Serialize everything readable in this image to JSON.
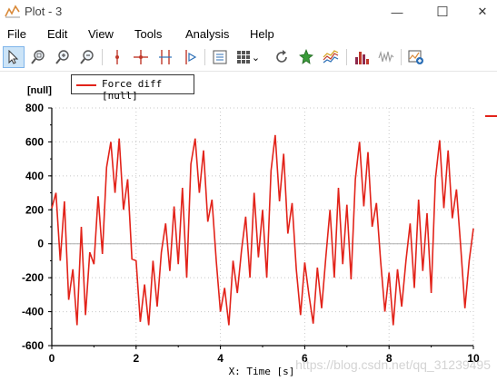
{
  "window": {
    "title": "Plot - 3"
  },
  "window_controls": {
    "minimize": "—",
    "maximize": "☐",
    "close": "✕"
  },
  "menu": {
    "items": [
      "File",
      "Edit",
      "View",
      "Tools",
      "Analysis",
      "Help"
    ]
  },
  "toolbar": {
    "buttons": [
      "select-arrow-icon",
      "zoom-region-icon",
      "zoom-in-icon",
      "zoom-out-icon",
      "cursor-vertical-icon",
      "cursor-cross-icon",
      "cursor-pair-icon",
      "cursor-step-icon",
      "properties-list-icon",
      "layout-grid-icon",
      "refresh-icon",
      "pin-icon",
      "multi-line-icon",
      "histogram-icon",
      "waveform-icon",
      "new-plot-icon"
    ],
    "dropdown_arrow": "⌄"
  },
  "plot": {
    "y_unit": "[null]",
    "legend_label": "Force diff [null]",
    "x_axis_label": "X: Time [s]",
    "line_color": "#e2231a"
  },
  "watermark": "https://blog.csdn.net/qq_31239495",
  "chart_data": {
    "type": "line",
    "title": "",
    "xlabel": "X: Time [s]",
    "ylabel": "[null]",
    "xlim": [
      0,
      10
    ],
    "ylim": [
      -600,
      800
    ],
    "x_ticks": [
      0,
      2,
      4,
      6,
      8,
      10
    ],
    "y_ticks": [
      -600,
      -400,
      -200,
      0,
      200,
      400,
      600,
      800
    ],
    "grid": true,
    "legend_position": "top-left",
    "series": [
      {
        "name": "Force diff [null]",
        "color": "#e2231a",
        "x": [
          0.0,
          0.1,
          0.2,
          0.3,
          0.4,
          0.5,
          0.6,
          0.7,
          0.8,
          0.9,
          1.0,
          1.1,
          1.2,
          1.3,
          1.4,
          1.5,
          1.6,
          1.7,
          1.8,
          1.9,
          2.0,
          2.1,
          2.2,
          2.3,
          2.4,
          2.5,
          2.6,
          2.7,
          2.8,
          2.9,
          3.0,
          3.1,
          3.2,
          3.3,
          3.4,
          3.5,
          3.6,
          3.7,
          3.8,
          3.9,
          4.0,
          4.1,
          4.2,
          4.3,
          4.4,
          4.5,
          4.6,
          4.7,
          4.8,
          4.9,
          5.0,
          5.1,
          5.2,
          5.3,
          5.4,
          5.5,
          5.6,
          5.7,
          5.8,
          5.9,
          6.0,
          6.1,
          6.2,
          6.3,
          6.4,
          6.5,
          6.6,
          6.7,
          6.8,
          6.9,
          7.0,
          7.1,
          7.2,
          7.3,
          7.4,
          7.5,
          7.6,
          7.7,
          7.8,
          7.9,
          8.0,
          8.1,
          8.2,
          8.3,
          8.4,
          8.5,
          8.6,
          8.7,
          8.8,
          8.9,
          9.0,
          9.1,
          9.2,
          9.3,
          9.4,
          9.5,
          9.6,
          9.7,
          9.8,
          9.9,
          10.0
        ],
        "values": [
          210,
          300,
          -100,
          250,
          -330,
          -150,
          -480,
          100,
          -420,
          -50,
          -120,
          280,
          -60,
          450,
          600,
          300,
          620,
          200,
          380,
          -90,
          -100,
          -460,
          -240,
          -480,
          -100,
          -370,
          -50,
          120,
          -160,
          220,
          -120,
          330,
          -200,
          470,
          620,
          300,
          550,
          130,
          260,
          -100,
          -400,
          -260,
          -480,
          -100,
          -290,
          -40,
          160,
          -200,
          300,
          -80,
          200,
          -200,
          430,
          640,
          250,
          530,
          60,
          240,
          -150,
          -420,
          -110,
          -300,
          -470,
          -140,
          -380,
          -80,
          200,
          -200,
          330,
          -120,
          230,
          -210,
          380,
          600,
          220,
          540,
          100,
          240,
          -100,
          -400,
          -170,
          -480,
          -150,
          -370,
          -100,
          120,
          -260,
          260,
          -160,
          180,
          -290,
          380,
          610,
          210,
          550,
          150,
          320,
          -20,
          -380,
          -100,
          90
        ]
      }
    ]
  }
}
